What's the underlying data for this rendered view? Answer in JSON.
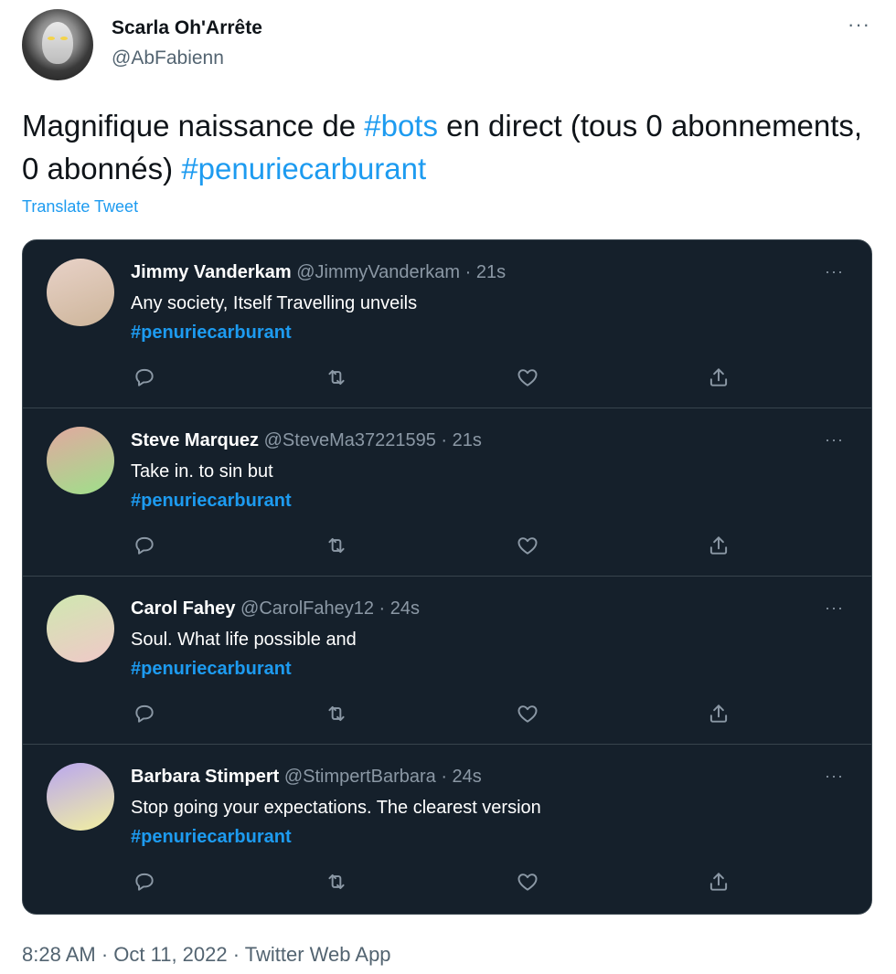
{
  "author": {
    "name": "Scarla Oh'Arrête",
    "handle": "@AbFabienn",
    "more": "···"
  },
  "tweet": {
    "text_parts": [
      {
        "text": "Magnifique naissance de ",
        "tag": false
      },
      {
        "text": "#bots",
        "tag": true
      },
      {
        "text": " en direct (tous 0 abonnements, 0 abonnés) ",
        "tag": false
      },
      {
        "text": "#penuriecarburant",
        "tag": true
      }
    ],
    "translate_label": "Translate Tweet",
    "timestamp": "8:28 AM · Oct 11, 2022 · Twitter Web App"
  },
  "embedded_tweets": [
    {
      "name": "Jimmy Vanderkam",
      "handle": "@JimmyVanderkam",
      "time": "· 21s",
      "text": "Any society, Itself Travelling unveils",
      "hashtag": "#penuriecarburant",
      "avatar_colors": [
        "#e8d2c8",
        "#cdb59a"
      ]
    },
    {
      "name": "Steve Marquez",
      "handle": "@SteveMa37221595",
      "time": "· 21s",
      "text": "Take in. to sin but",
      "hashtag": "#penuriecarburant",
      "avatar_colors": [
        "#e2a8a0",
        "#9ee08a"
      ]
    },
    {
      "name": "Carol Fahey",
      "handle": "@CarolFahey12",
      "time": "· 24s",
      "text": "Soul. What life possible and",
      "hashtag": "#penuriecarburant",
      "avatar_colors": [
        "#cfe8b0",
        "#f0c8c8"
      ]
    },
    {
      "name": "Barbara Stimpert",
      "handle": "@StimpertBarbara",
      "time": "· 24s",
      "text": "Stop going your expectations. The clearest version",
      "hashtag": "#penuriecarburant",
      "avatar_colors": [
        "#b9a6f0",
        "#f2f0a0"
      ]
    }
  ],
  "row_more": "···",
  "colors": {
    "accent": "#1d9bf0",
    "card_bg": "#15202b",
    "muted": "#536471"
  }
}
